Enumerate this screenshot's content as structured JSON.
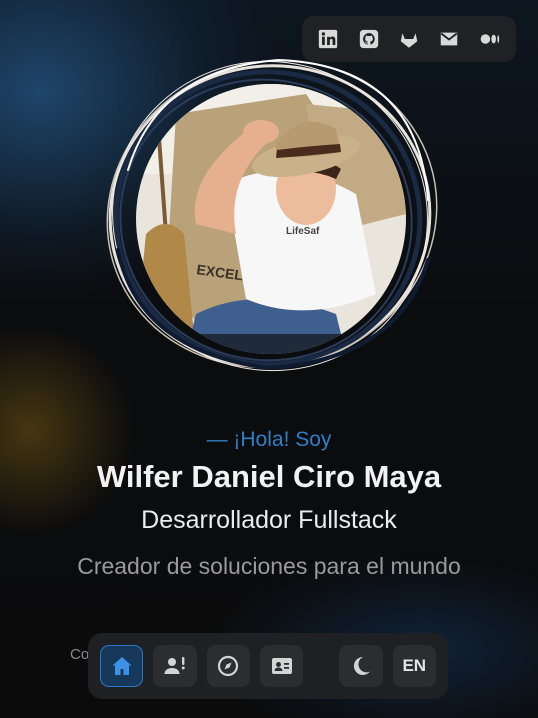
{
  "colors": {
    "accent": "#2d7fc8",
    "background": "#0c0c0d",
    "dock": "#1f2023"
  },
  "social": [
    {
      "name": "linkedin-icon",
      "label": "LinkedIn"
    },
    {
      "name": "github-icon",
      "label": "GitHub"
    },
    {
      "name": "gitlab-icon",
      "label": "GitLab"
    },
    {
      "name": "mail-icon",
      "label": "Email"
    },
    {
      "name": "medium-icon",
      "label": "Medium"
    }
  ],
  "hero": {
    "greeting": "— ¡Hola! Soy",
    "name": "Wilfer Daniel Ciro Maya",
    "role": "Desarrollador Fullstack",
    "tagline": "Creador de soluciones para el mundo"
  },
  "photo": {
    "sack_text": "EXCELSO",
    "shirt_text": "LifeSaf"
  },
  "footer": {
    "partial_text": "Co"
  },
  "dock": {
    "items": [
      {
        "name": "home-icon",
        "active": true
      },
      {
        "name": "about-icon",
        "active": false
      },
      {
        "name": "compass-icon",
        "active": false
      },
      {
        "name": "contact-card-icon",
        "active": false
      }
    ],
    "theme_icon": "moon-icon",
    "lang_label": "EN"
  }
}
